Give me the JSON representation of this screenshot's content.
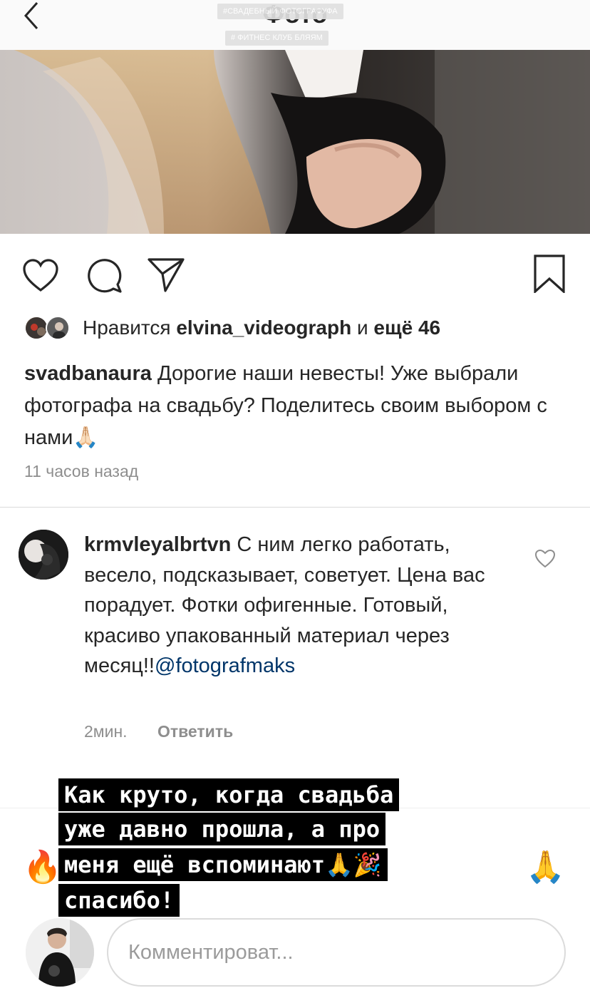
{
  "header": {
    "title": "Фото",
    "tag_top": "#СВАДЕБНЫЙ ФОТОГРАФУФА",
    "tag_bottom": "# ФИТНЕС КЛУБ БЛЯЯМ"
  },
  "actions": {
    "like_icon": "heart-outline-icon",
    "comment_icon": "comment-bubble-icon",
    "share_icon": "paper-plane-icon",
    "save_icon": "bookmark-icon"
  },
  "likes": {
    "prefix": "Нравится",
    "user": "elvina_videograph",
    "conjunction": "и",
    "more": "ещё 46"
  },
  "caption": {
    "author": "svadbanaura",
    "text": "Дорогие наши невесты! Уже выбрали фотографа на свадьбу? Поделитесь своим выбором  с нами",
    "emoji": "🙏🏻",
    "timestamp": "11 часов назад"
  },
  "comment": {
    "author": "krmvleyalbrtvn",
    "text": "С ним легко работать, весело, подсказывает, советует. Цена вас порадует. Фотки офигенные. Готовый, красиво упакованный материал через месяц!!",
    "mention": "@fotografmaks",
    "time": "2мин.",
    "reply": "Ответить"
  },
  "emoji_row": {
    "fire": "🔥",
    "pray": "🙏"
  },
  "sticker": {
    "line1": "Как круто, когда свадьба",
    "line2": "уже давно прошла, а про",
    "line3": "меня ещё вспоминают🙏🎉",
    "line4": "спасибо!"
  },
  "composer": {
    "placeholder": "Комментироват..."
  },
  "colors": {
    "link": "#003569",
    "muted": "#8e8e8e",
    "text": "#262626",
    "divider": "#dbdbdb"
  }
}
